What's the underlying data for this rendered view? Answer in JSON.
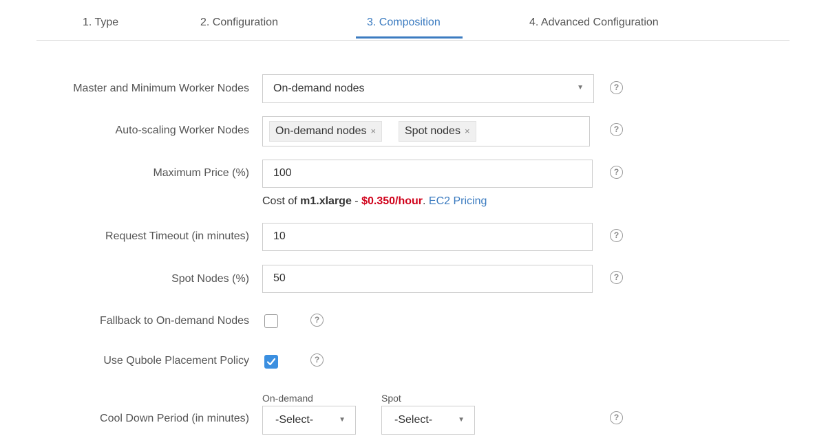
{
  "tabs": [
    {
      "label": "1. Type"
    },
    {
      "label": "2. Configuration"
    },
    {
      "label": "3. Composition"
    },
    {
      "label": "4. Advanced Configuration"
    }
  ],
  "active_tab": "3. Composition",
  "colors": {
    "accent": "#3b7bc0",
    "price": "#d0021b",
    "checkbox": "#3b8fe0"
  },
  "form": {
    "master_nodes": {
      "label": "Master and Minimum Worker Nodes",
      "value": "On-demand nodes"
    },
    "autoscaling": {
      "label": "Auto-scaling Worker Nodes",
      "tags": [
        "On-demand nodes",
        "Spot nodes"
      ]
    },
    "max_price": {
      "label": "Maximum Price (%)",
      "value": "100"
    },
    "cost": {
      "prefix": "Cost of ",
      "instance": "m1.xlarge",
      "separator": " - ",
      "price": "$0.350/hour",
      "dot": ". ",
      "link": "EC2 Pricing"
    },
    "request_timeout": {
      "label": "Request Timeout (in minutes)",
      "value": "10"
    },
    "spot_nodes": {
      "label": "Spot Nodes (%)",
      "value": "50"
    },
    "fallback": {
      "label": "Fallback to On-demand Nodes",
      "checked": false
    },
    "placement": {
      "label": "Use Qubole Placement Policy",
      "checked": true
    },
    "cooldown": {
      "label": "Cool Down Period (in minutes)",
      "ondemand_label": "On-demand",
      "spot_label": "Spot",
      "ondemand_value": "-Select-",
      "spot_value": "-Select-"
    }
  },
  "help_glyph": "?",
  "remove_glyph": "×",
  "dropdown_glyph": "▼"
}
